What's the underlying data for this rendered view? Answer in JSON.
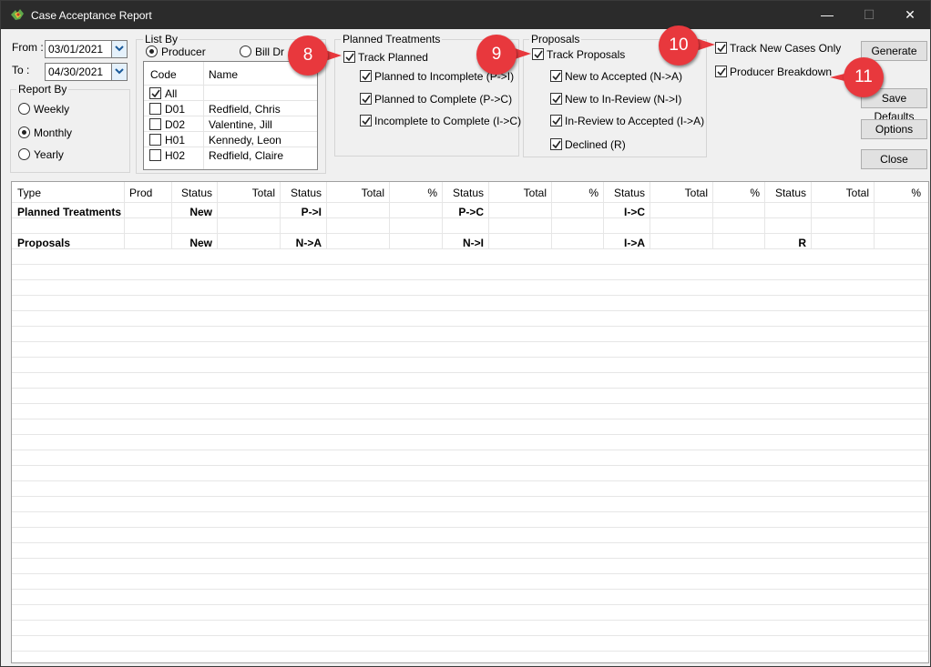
{
  "window": {
    "title": "Case Acceptance Report",
    "controls": {
      "minimize": "—",
      "maximize": "☐",
      "close": "✕"
    }
  },
  "date_range": {
    "from_label": "From :",
    "from_value": "03/01/2021",
    "to_label": "To :",
    "to_value": "04/30/2021"
  },
  "report_by": {
    "title": "Report By",
    "options": [
      "Weekly",
      "Monthly",
      "Yearly"
    ],
    "selected": "Monthly"
  },
  "list_by": {
    "title": "List By",
    "options": [
      "Producer",
      "Bill Dr"
    ],
    "selected": "Producer",
    "columns": [
      "Code",
      "Name"
    ],
    "all_label": "All",
    "rows": [
      {
        "code": "D01",
        "name": "Redfield, Chris"
      },
      {
        "code": "D02",
        "name": "Valentine, Jill"
      },
      {
        "code": "H01",
        "name": "Kennedy, Leon"
      },
      {
        "code": "H02",
        "name": "Redfield, Claire"
      }
    ]
  },
  "planned_treatments": {
    "title": "Planned Treatments",
    "track_label": "Track Planned",
    "items": [
      "Planned to Incomplete (P->I)",
      "Planned to Complete (P->C)",
      "Incomplete to Complete (I->C)"
    ]
  },
  "proposals": {
    "title": "Proposals",
    "track_label": "Track Proposals",
    "items": [
      "New to Accepted (N->A)",
      "New to In-Review (N->I)",
      "In-Review to Accepted (I->A)",
      "Declined (R)"
    ]
  },
  "options_panel": {
    "track_new_cases": "Track New Cases Only",
    "producer_breakdown": "Producer Breakdown"
  },
  "buttons": {
    "generate": "Generate",
    "save_defaults": "Save Defaults",
    "options": "Options",
    "close": "Close"
  },
  "callouts": [
    "8",
    "9",
    "10",
    "11"
  ],
  "callout_color": "#e8383d",
  "grid": {
    "headers": [
      "Type",
      "Prod",
      "Status",
      "Total",
      "Status",
      "Total",
      "%",
      "Status",
      "Total",
      "%",
      "Status",
      "Total",
      "%",
      "Status",
      "Total",
      "%"
    ],
    "rows": [
      {
        "type": "Planned Treatments",
        "s1": "New",
        "s2": "P->I",
        "s3": "P->C",
        "s4": "I->C",
        "s5": ""
      },
      {
        "type": "Proposals",
        "s1": "New",
        "s2": "N->A",
        "s3": "N->I",
        "s4": "I->A",
        "s5": "R"
      }
    ]
  }
}
